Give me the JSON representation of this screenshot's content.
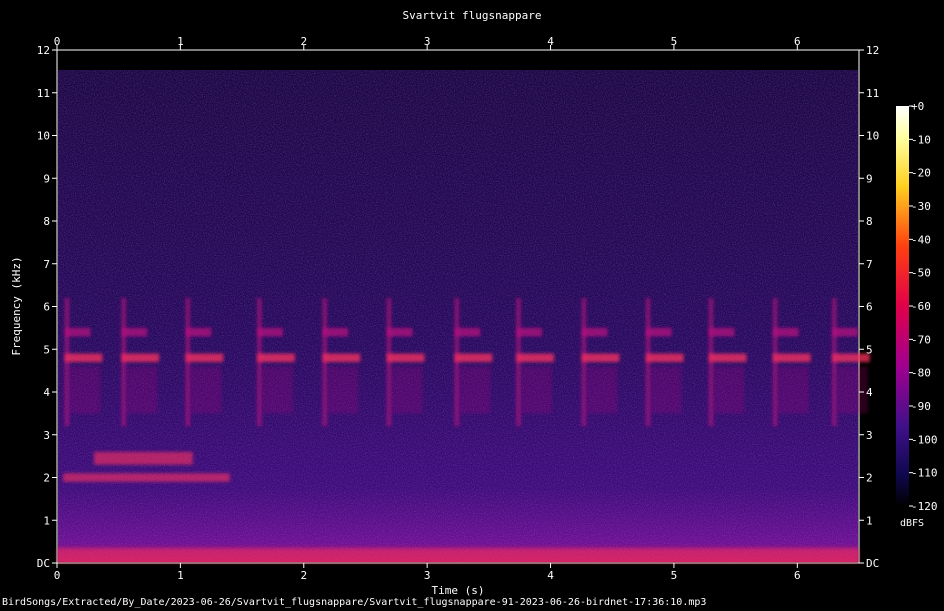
{
  "chart_data": {
    "type": "heatmap",
    "title": "Svartvit flugsnappare",
    "xlabel": "Time (s)",
    "ylabel": "Frequency (kHz)",
    "xlim": [
      0,
      6.5
    ],
    "ylim": [
      0,
      12
    ],
    "x_ticks": [
      "0",
      "1",
      "2",
      "3",
      "4",
      "5",
      "6"
    ],
    "y_ticks": [
      "DC",
      "1",
      "2",
      "3",
      "4",
      "5",
      "6",
      "7",
      "8",
      "9",
      "10",
      "11",
      "12"
    ],
    "colorbar": {
      "label": "dBFS",
      "ticks": [
        "+0",
        "-10",
        "-20",
        "-30",
        "-40",
        "-50",
        "-60",
        "-70",
        "-80",
        "-90",
        "-100",
        "-110",
        "-120"
      ],
      "range": [
        -120,
        0
      ]
    },
    "colors": {
      "background": "#000000",
      "noise": "#2a0f60",
      "call": "#c01080",
      "hot": "#ff3060"
    },
    "song_syllables_s": [
      0.06,
      0.52,
      1.04,
      1.62,
      2.15,
      2.67,
      3.22,
      3.72,
      4.25,
      4.77,
      5.28,
      5.8,
      6.28
    ],
    "calls_kHz": [
      4.8,
      5.4
    ],
    "low_band_kHz": [
      2.0,
      2.6
    ]
  },
  "footer": {
    "path": "BirdSongs/Extracted/By_Date/2023-06-26/Svartvit_flugsnappare/Svartvit_flugsnappare-91-2023-06-26-birdnet-17:36:10.mp3"
  }
}
